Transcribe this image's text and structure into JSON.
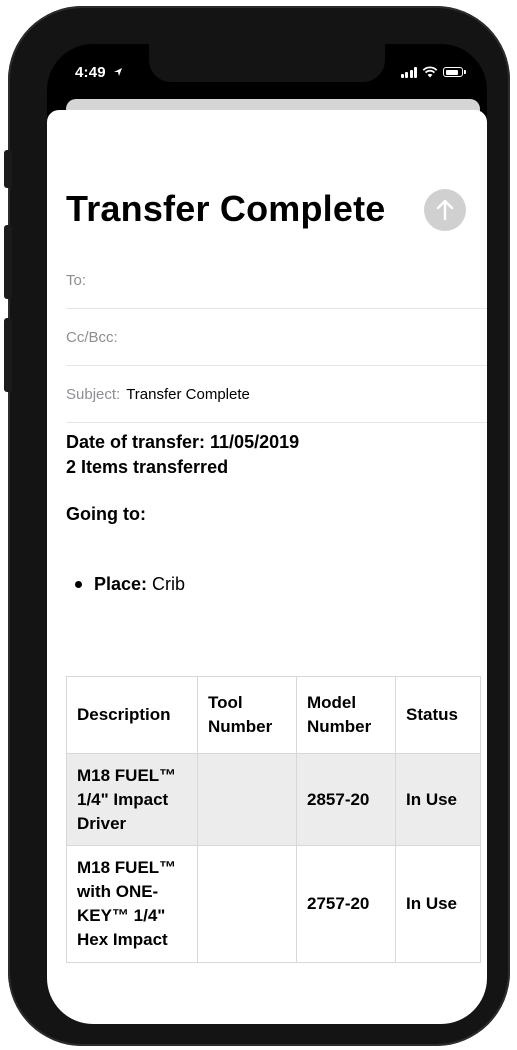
{
  "status_bar": {
    "time": "4:49",
    "location_arrow": "➤"
  },
  "compose": {
    "title": "Transfer Complete",
    "to_label": "To:",
    "to_value": "",
    "cc_label": "Cc/Bcc:",
    "cc_value": "",
    "subject_label": "Subject:",
    "subject_value": "Transfer Complete",
    "send_icon": "arrow-up-icon"
  },
  "email_body": {
    "date_line": "Date of transfer: 11/05/2019",
    "count_line": "2 Items transferred",
    "going_to": "Going to:",
    "place_label": "Place:",
    "place_value": " Crib"
  },
  "table": {
    "headers": [
      "Description",
      "Tool Number",
      "Model Number",
      "Status"
    ],
    "rows": [
      {
        "description": "M18 FUEL™ 1/4\" Impact Driver",
        "tool_number": "",
        "model_number": "2857-20",
        "status": "In Use"
      },
      {
        "description": "M18 FUEL™ with ONE-KEY™ 1/4\" Hex Impact",
        "tool_number": "",
        "model_number": "2757-20",
        "status": "In Use"
      }
    ]
  },
  "colors": {
    "frame": "#141414",
    "send_button_disabled": "#d0d0d0",
    "field_label": "#8e8e93",
    "row_shade": "#ececec"
  }
}
